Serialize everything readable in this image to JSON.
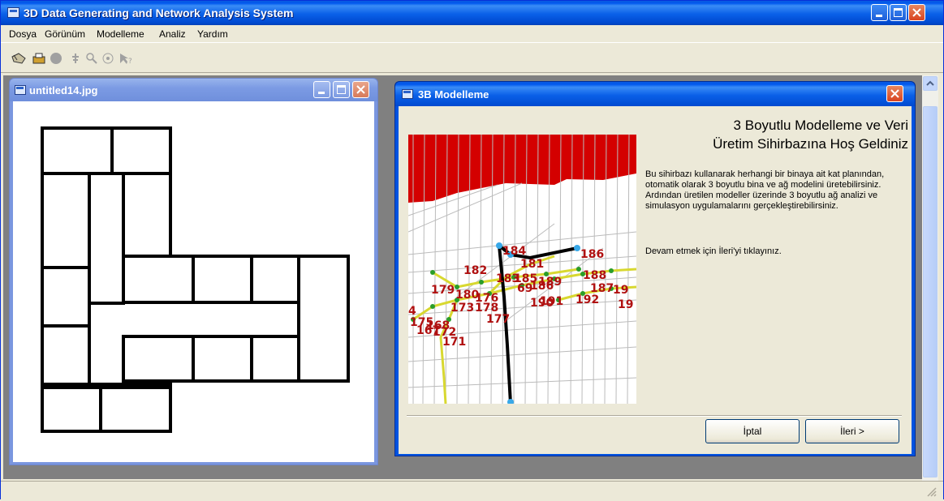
{
  "app": {
    "title": "3D Data Generating and Network Analysis System"
  },
  "menu": [
    "Dosya",
    "Görünüm",
    "Modelleme",
    "Analiz",
    "Yardım"
  ],
  "toolbar": {
    "icons": [
      "hand-pointer-icon",
      "printer-icon",
      "circle-icon",
      "pan-icon",
      "zoom-icon",
      "target-icon",
      "query-icon"
    ]
  },
  "child_window_1": {
    "title": "untitled14.jpg"
  },
  "child_window_2": {
    "title": "3B Modelleme",
    "heading_line1": "3 Boyutlu Modelleme ve Veri",
    "heading_line2": "Üretim Sihirbazına Hoş Geldiniz",
    "description": "Bu sihirbazı kullanarak herhangi bir binaya ait kat planından, otomatik olarak 3 boyutlu bina ve ağ modelini üretebilirsiniz. Ardından üretilen modeller üzerinde 3 boyutlu ağ analizi ve simulasyon uygulamalarını gerçekleştirebilirsiniz.",
    "continue_text": "Devam etmek için İleri'yi tıklayınız.",
    "cancel_label": "İptal",
    "next_label": "İleri >",
    "node_labels": [
      "184",
      "186",
      "181",
      "182",
      "183",
      "185",
      "188",
      "189",
      "186",
      "69",
      "187",
      "19",
      "179",
      "180",
      "176",
      "190",
      "191",
      "192",
      "173",
      "178",
      "19",
      "177",
      "4",
      "175",
      "168",
      "167",
      "172",
      "171"
    ]
  },
  "colors": {
    "title_blue": "#0058ee",
    "inactive_title": "#7c9be4",
    "close_red": "#d9431f",
    "face": "#ece9d8",
    "mdi_bg": "#808080",
    "red_roof": "#d40000",
    "network_yellow": "#d8d830"
  }
}
